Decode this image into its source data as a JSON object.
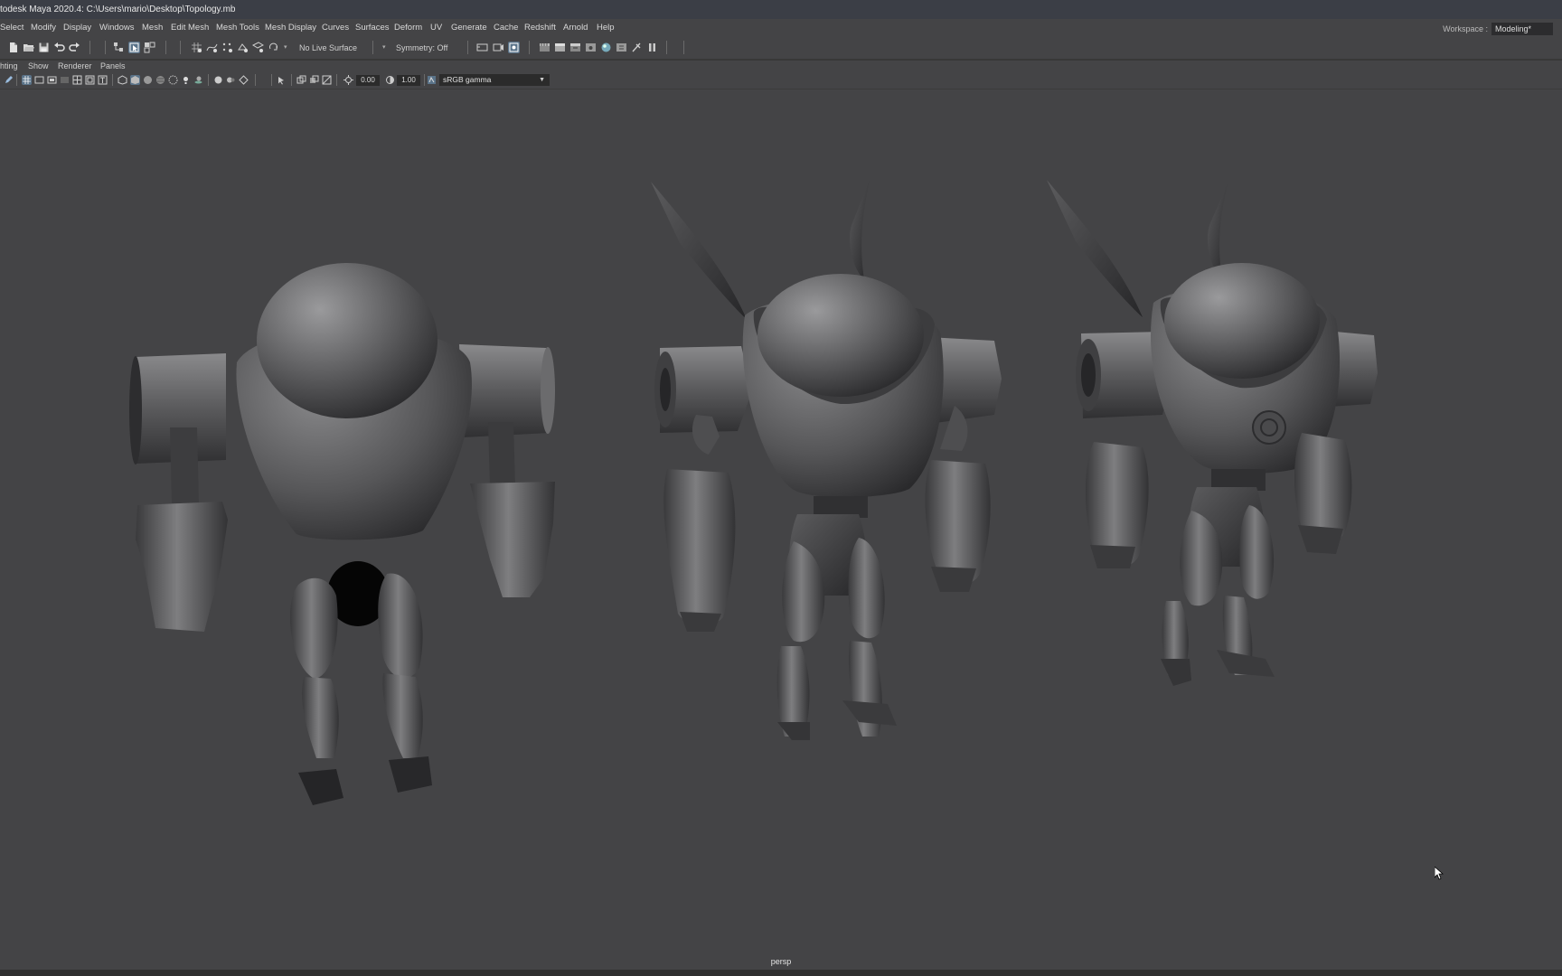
{
  "titlebar": {
    "title": "todesk Maya 2020.4: C:\\Users\\mario\\Desktop\\Topology.mb"
  },
  "menubar": {
    "items": [
      "Select",
      "Modify",
      "Display",
      "Windows",
      "Mesh",
      "Edit Mesh",
      "Mesh Tools",
      "Mesh Display",
      "Curves",
      "Surfaces",
      "Deform",
      "UV",
      "Generate",
      "Cache",
      "Redshift",
      "Arnold",
      "Help"
    ]
  },
  "workspace": {
    "label": "Workspace :",
    "value": "Modeling*"
  },
  "statusline": {
    "live_surface": "No Live Surface",
    "symmetry": "Symmetry: Off"
  },
  "panel_menu": {
    "items": [
      "hting",
      "Show",
      "Renderer",
      "Panels"
    ]
  },
  "panel_toolbar": {
    "exposure": "0.00",
    "gamma": "1.00",
    "color_space": "sRGB gamma"
  },
  "viewport": {
    "camera": "persp"
  },
  "icons": {
    "file": [
      "new-scene-icon",
      "open-scene-icon",
      "save-scene-icon",
      "undo-icon",
      "redo-icon"
    ],
    "select": [
      "select-hierarchy-icon",
      "select-object-icon",
      "select-component-icon"
    ],
    "snap": [
      "snap-grid-icon",
      "snap-curve-icon",
      "snap-point-icon",
      "snap-projected-icon",
      "snap-view-plane-icon",
      "make-live-icon"
    ],
    "render": [
      "render-view-icon",
      "render-current-icon",
      "ipr-render-icon",
      "render-settings-icon",
      "hypershade-icon",
      "light-editor-icon",
      "pause-viewport-icon",
      "arnold-render-icon"
    ]
  },
  "colors": {
    "viewport_bg": "#444446",
    "title_bg": "#3b3e46",
    "highlight": "#5a7389"
  }
}
